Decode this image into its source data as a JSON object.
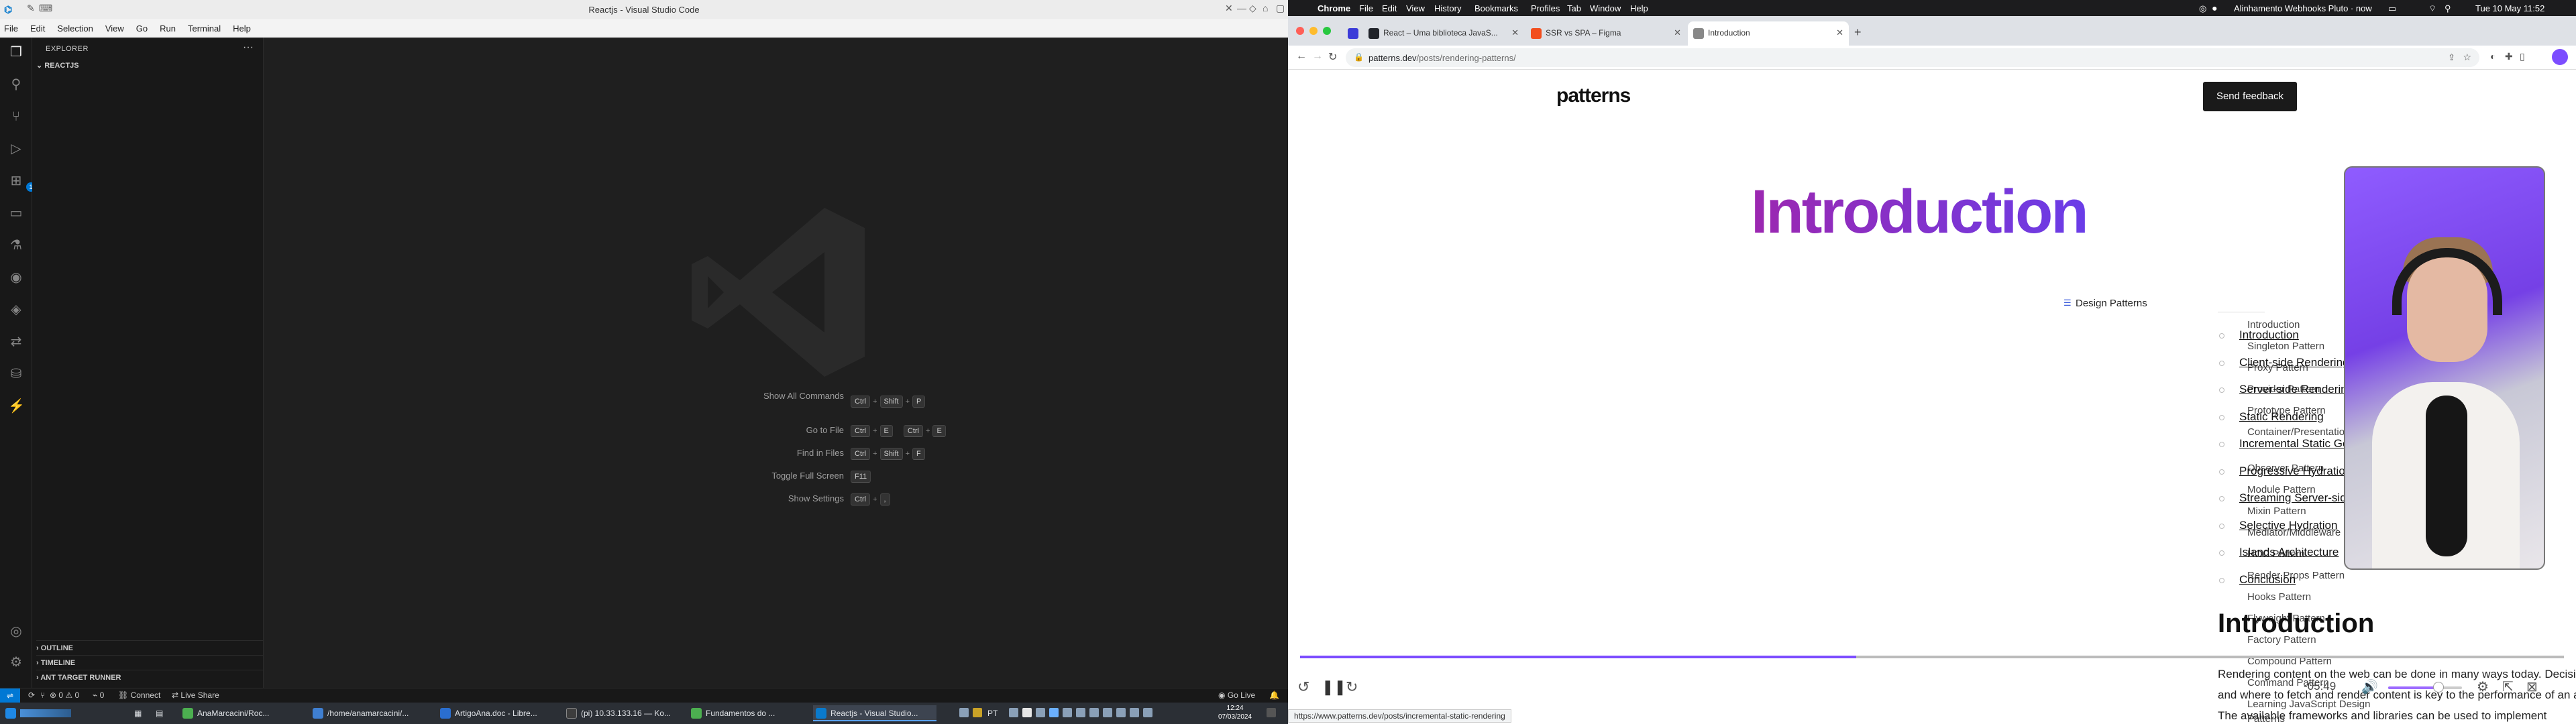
{
  "vscode": {
    "window_title": "Reactjs - Visual Studio Code",
    "menu": [
      "File",
      "Edit",
      "Selection",
      "View",
      "Go",
      "Run",
      "Terminal",
      "Help"
    ],
    "explorer_label": "EXPLORER",
    "folder": "REACTJS",
    "sections": [
      "OUTLINE",
      "TIMELINE",
      "ANT TARGET RUNNER"
    ],
    "shortcuts": [
      {
        "label": "Show All Commands",
        "keys": [
          [
            "Ctrl",
            "Shift",
            "P"
          ]
        ]
      },
      {
        "label": "Go to File",
        "keys": [
          [
            "Ctrl",
            "E"
          ],
          [
            "Ctrl",
            "E"
          ]
        ]
      },
      {
        "label": "Find in Files",
        "keys": [
          [
            "Ctrl",
            "Shift",
            "F"
          ]
        ]
      },
      {
        "label": "Toggle Full Screen",
        "keys": [
          [
            "F11"
          ]
        ]
      },
      {
        "label": "Show Settings",
        "keys": [
          [
            "Ctrl",
            ","
          ]
        ]
      }
    ],
    "status": {
      "errors": "0",
      "warnings": "0",
      "ports": "0",
      "connect": "Connect",
      "liveshare": "Live Share",
      "golive": "Go Live"
    }
  },
  "taskbar": {
    "items": [
      {
        "label": "AnaMarcacini/Roc...",
        "color": "#4caf50",
        "active": false
      },
      {
        "label": "/home/anamarcacini/...",
        "color": "#3f7fd1",
        "active": false
      },
      {
        "label": "ArtigoAna.doc - Libre...",
        "color": "#2a6ecf",
        "active": false
      },
      {
        "label": "(pi) 10.33.133.16 — Ko...",
        "color": "#3d3d3d",
        "active": false
      },
      {
        "label": "Fundamentos do ...",
        "color": "#4caf50",
        "active": false
      },
      {
        "label": "Reactjs - Visual Studio...",
        "color": "#0a7acc",
        "active": true
      }
    ],
    "lang": "PT",
    "time": "12:24",
    "date": "07/03/2024"
  },
  "mac": {
    "menu": [
      "Chrome",
      "File",
      "Edit",
      "View",
      "History",
      "Bookmarks",
      "Profiles",
      "Tab",
      "Window",
      "Help"
    ],
    "status_text": "Alinhamento Webhooks Pluto · now",
    "clock": "Tue 10 May  11:52"
  },
  "chrome": {
    "tabs": [
      {
        "title": "React – Uma biblioteca JavaS...",
        "color": "#20232a",
        "active": false
      },
      {
        "title": "SSR vs SPA – Figma",
        "color": "#f24e1e",
        "active": false
      },
      {
        "title": "Introduction",
        "color": "#888",
        "active": true
      }
    ],
    "url_host": "patterns.dev",
    "url_path": "/posts/rendering-patterns/"
  },
  "page": {
    "logo": "patterns",
    "feedback": "Send feedback",
    "hero_title": "Introduction",
    "sidebar_heading": "Design Patterns",
    "sidebar_items": [
      "Introduction",
      "Singleton Pattern",
      "Proxy Pattern",
      "Provider Pattern",
      "Prototype Pattern",
      "Container/Presentational Pattern",
      "Observer Pattern",
      "Module Pattern",
      "Mixin Pattern",
      "Mediator/Middleware Pattern",
      "HOC Pattern",
      "Render Props Pattern",
      "Hooks Pattern",
      "Flyweight Pattern",
      "Factory Pattern",
      "Compound Pattern",
      "Command Pattern",
      "Learning JavaScript Design Patterns"
    ],
    "toc": [
      "Introduction",
      "Client-side Rendering",
      "Server-side Rendering",
      "Static Rendering",
      "Incremental Static Generation",
      "Progressive Hydration",
      "Streaming Server-side Rendering",
      "Selective Hydration",
      "Islands Architecture",
      "Conclusion"
    ],
    "content_heading": "Introduction",
    "content_paragraph": "Rendering content on the web can be done in many ways today. Decision on how and where to fetch and render content is key to the performance of an application. The available frameworks and libraries can be used to implement",
    "status_link": "https://www.patterns.dev/posts/incremental-static-rendering"
  },
  "video": {
    "time_remaining": "-05:49",
    "progress": 0.44,
    "volume": 0.68
  }
}
